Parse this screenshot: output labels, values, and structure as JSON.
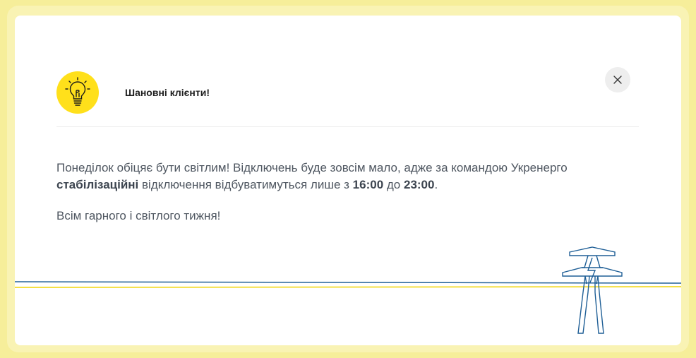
{
  "notice": {
    "title": "Шановні клієнти!",
    "close_icon": "close-icon",
    "bulb_icon": "lightbulb-icon",
    "paragraph1": {
      "part1": "Понеділок обіцяє бути світлим! Відключень буде зовсім мало, адже за командою Укренерго ",
      "bold1": "стабілізаційні",
      "part2": " відключення відбуватимуться лише з ",
      "bold2": "16:00",
      "part3": " до ",
      "bold3": "23:00",
      "part4": "."
    },
    "paragraph2": "Всім гарного і світлого тижня!"
  },
  "colors": {
    "accent_yellow": "#ffe01b",
    "frame_yellow": "#f6ee9a",
    "line_blue": "#1f5f96",
    "line_yellow": "#f0d400"
  },
  "decoration_icon": "power-tower-icon"
}
